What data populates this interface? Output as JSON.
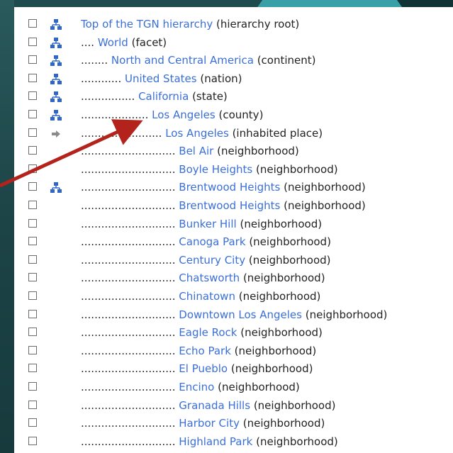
{
  "colors": {
    "link": "#3a6fd8",
    "text": "#222222",
    "icon_blue": "#2f66c8",
    "icon_gray": "#8a8a8a",
    "arrow": "#b3221b"
  },
  "rows": [
    {
      "prefix": "",
      "link": "Top of the TGN hierarchy",
      "suffix": "(hierarchy root)",
      "icon": "hierarchy-icon"
    },
    {
      "prefix": ".... ",
      "link": "World",
      "suffix": "(facet)",
      "icon": "hierarchy-icon"
    },
    {
      "prefix": "........ ",
      "link": "North and Central America",
      "suffix": "(continent)",
      "icon": "hierarchy-icon"
    },
    {
      "prefix": "............ ",
      "link": "United States",
      "suffix": "(nation)",
      "icon": "hierarchy-icon"
    },
    {
      "prefix": "................ ",
      "link": "California",
      "suffix": "(state)",
      "icon": "hierarchy-icon"
    },
    {
      "prefix": ".................... ",
      "link": "Los Angeles",
      "suffix": "(county)",
      "icon": "hierarchy-icon"
    },
    {
      "prefix": "........................ ",
      "link": "Los Angeles",
      "suffix": "(inhabited place)",
      "icon": "arrow-right-icon"
    },
    {
      "prefix": "............................ ",
      "link": "Bel Air",
      "suffix": "(neighborhood)",
      "icon": ""
    },
    {
      "prefix": "............................ ",
      "link": "Boyle Heights",
      "suffix": "(neighborhood)",
      "icon": ""
    },
    {
      "prefix": "............................ ",
      "link": "Brentwood Heights",
      "suffix": "(neighborhood)",
      "icon": "hierarchy-icon"
    },
    {
      "prefix": "............................ ",
      "link": "Brentwood Heights",
      "suffix": "(neighborhood)",
      "icon": ""
    },
    {
      "prefix": "............................ ",
      "link": "Bunker Hill",
      "suffix": "(neighborhood)",
      "icon": ""
    },
    {
      "prefix": "............................ ",
      "link": "Canoga Park",
      "suffix": "(neighborhood)",
      "icon": ""
    },
    {
      "prefix": "............................ ",
      "link": "Century City",
      "suffix": "(neighborhood)",
      "icon": ""
    },
    {
      "prefix": "............................ ",
      "link": "Chatsworth",
      "suffix": "(neighborhood)",
      "icon": ""
    },
    {
      "prefix": "............................ ",
      "link": "Chinatown",
      "suffix": "(neighborhood)",
      "icon": ""
    },
    {
      "prefix": "............................ ",
      "link": "Downtown Los Angeles",
      "suffix": "(neighborhood)",
      "icon": ""
    },
    {
      "prefix": "............................ ",
      "link": "Eagle Rock",
      "suffix": "(neighborhood)",
      "icon": ""
    },
    {
      "prefix": "............................ ",
      "link": "Echo Park",
      "suffix": "(neighborhood)",
      "icon": ""
    },
    {
      "prefix": "............................ ",
      "link": "El Pueblo",
      "suffix": "(neighborhood)",
      "icon": ""
    },
    {
      "prefix": "............................ ",
      "link": "Encino",
      "suffix": "(neighborhood)",
      "icon": ""
    },
    {
      "prefix": "............................ ",
      "link": "Granada Hills",
      "suffix": "(neighborhood)",
      "icon": ""
    },
    {
      "prefix": "............................ ",
      "link": "Harbor City",
      "suffix": "(neighborhood)",
      "icon": ""
    },
    {
      "prefix": "............................ ",
      "link": "Highland Park",
      "suffix": "(neighborhood)",
      "icon": ""
    }
  ]
}
